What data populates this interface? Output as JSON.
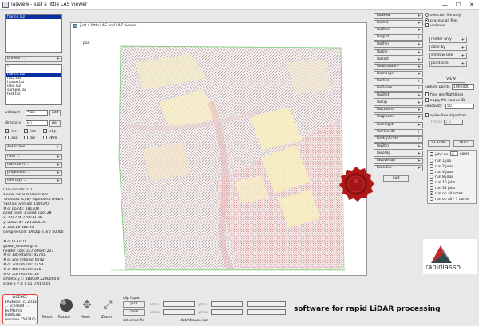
{
  "window": {
    "title": "lasview - just a little LAS viewer",
    "minimize": "—",
    "maximize": "☐",
    "close": "✕"
  },
  "left": {
    "selected_files": [
      "france.laz"
    ],
    "browse_label": "browse ...",
    "file_list": [
      "\\",
      "..",
      "france.laz",
      "fusa.laz",
      "house.laz",
      "lake.laz",
      "sample.laz",
      "test.laz"
    ],
    "selected_file_index": 2,
    "wildcard_label": "wildcard",
    "wildcard_value": "*.laz",
    "add_label": "add",
    "directory_label": "directory",
    "directory_value": "E:\\",
    "go_label": "go",
    "filetypes": [
      {
        "label": ".las",
        "checked": true
      },
      {
        "label": ".laz",
        "checked": true
      },
      {
        "label": ".shp",
        "checked": false
      },
      {
        "label": ".asc",
        "checked": false
      },
      {
        "label": ".bil",
        "checked": false
      },
      {
        "label": ".dtm",
        "checked": false
      }
    ],
    "ascii_files": "ASCII files ...",
    "filter": "filter ...",
    "transform": "transform ...",
    "projection": "projection ...",
    "overlays": "overlays ...",
    "info": [
      "LAS version: 1.1",
      "source ID:   0   created: 0/0",
      "'LAStools (c) by rapidlasso GmbH'",
      "'las2las (version 150629)'",
      "# of points: 181200",
      "point type: 1 point size: 28",
      "x: 278734 279033.99",
      "y: 2282787 2283086.99",
      "z: 348.29 382.93",
      "compression: LASzip 2.4r0 50000",
      "",
      "# of VLRs: 0",
      "global_encoding: 0",
      "header size: 227  offset: 227",
      "# of 1st returns: 92781",
      "# of 2nd returns: 6742",
      "# of 3rd returns: 1459",
      "# of 4th returns: 226",
      "# of 5th returns: 16",
      "offset x y z: 880000 2280000 0",
      "scale x y z: 0.01 0.01 0.01"
    ]
  },
  "viewer": {
    "title": "just a little LAS and LAZ viewer",
    "mode_label": "pan"
  },
  "tools": [
    "lasview",
    "lasinfo",
    "las2las",
    "lasgrid",
    "lasthin",
    "lastile",
    "lassort",
    "lasboundary",
    "lasmerge",
    "las2iso",
    "las2dem",
    "las2txt",
    "lascip",
    "lascontrol",
    "lasground",
    "lasheight",
    "lasclassify",
    "lasduplicate",
    "las2tin",
    "las2shp",
    "lasoverlap",
    "lasindex"
  ],
  "quit_label": "quit",
  "right": {
    "options": [
      {
        "label": "selected file only",
        "kind": "radio",
        "on": false
      },
      {
        "label": "process all files",
        "kind": "radio",
        "on": true
      },
      {
        "label": "verbose",
        "kind": "check",
        "on": false
      }
    ],
    "render": "render only",
    "color": "color by",
    "window": "window size",
    "point": "point size",
    "view_label": "VIEW",
    "sample_label": "sample points",
    "sample_value": "1000000",
    "flight_label": "files are flightlines",
    "source_label": "apply file source ID",
    "concavity_label": "concavity",
    "concavity_value": "50",
    "spike_label": "spike-free algorithm",
    "freeze_label": "freeze",
    "freeze_value": "1.5",
    "readme": "README",
    "quit2": "QUIT",
    "jobs_label": "jobs on",
    "cores_label": "cores",
    "jobs_value": "4",
    "run_options": [
      {
        "label": "run 1 job",
        "on": false
      },
      {
        "label": "run 2 jobs",
        "on": false
      },
      {
        "label": "run 4 jobs",
        "on": false
      },
      {
        "label": "run 8 jobs",
        "on": false
      },
      {
        "label": "run 16 jobs",
        "on": false
      },
      {
        "label": "run 32 jobs",
        "on": false
      },
      {
        "label": "run on all cores",
        "on": true
      },
      {
        "label": "run on all - 1 cores",
        "on": false
      }
    ],
    "logo_text": "rapidlasso"
  },
  "bottom": {
    "license_title": "LICENSE",
    "license_lines": [
      "LAStools (c) 2013",
      "... licensed ... ",
      "by Martin Isenburg",
      "(version 150310)"
    ],
    "reset": "Reset",
    "rotate": "Rotate",
    "move": "Move",
    "zoom": "Zoom",
    "clip_label": "clip input",
    "pick_label": "pick",
    "clear_label": "clear",
    "fields": [
      "xmin",
      "ymin",
      "xmax",
      "ymax"
    ],
    "selected_label": "selected file",
    "selected_value": "data\\france.laz",
    "tagline": "software for rapid LiDAR processing"
  },
  "colors": {
    "accent": "#0a2fa0",
    "license_border": "#e84040",
    "seal": "#b01818"
  }
}
